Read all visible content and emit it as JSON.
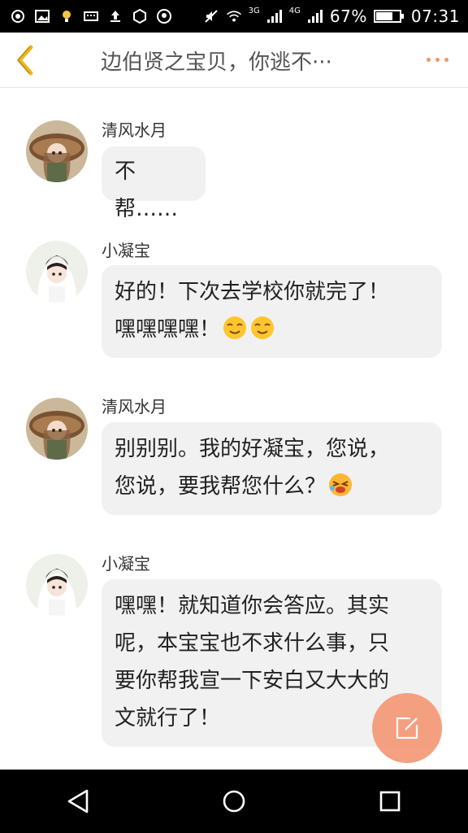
{
  "status_bar": {
    "network_3g": "3G",
    "network_4g": "4G",
    "battery": "67%",
    "time": "07:31"
  },
  "header": {
    "title": "边伯贤之宝贝，你逃不···"
  },
  "messages": [
    {
      "sender": "清风水月",
      "avatar": "girl-hat-avatar",
      "text": "不帮……",
      "emoji": []
    },
    {
      "sender": "小凝宝",
      "avatar": "girl-white-avatar",
      "line1": "好的！下次去学校你就完了！",
      "line2": "嘿嘿嘿嘿！",
      "emoji": [
        "smirk-emoji",
        "smirk-emoji"
      ]
    },
    {
      "sender": "清风水月",
      "avatar": "girl-hat-avatar",
      "line1": "别别别。我的好凝宝，您说，",
      "line2": "您说，要我帮您什么？",
      "emoji": [
        "crying-emoji"
      ]
    },
    {
      "sender": "小凝宝",
      "avatar": "girl-white-avatar",
      "line1": "嘿嘿！就知道你会答应。其实",
      "line2": "呢，本宝宝也不求什么事，只",
      "line3": "要你帮我宣一下安白又大大的",
      "line4": "文就行了！"
    }
  ],
  "icons": {
    "back": "chevron-left-icon",
    "more": "more-dots-icon",
    "compose": "compose-icon"
  },
  "colors": {
    "accent": "#f59977",
    "back_arrow": "#f2b517",
    "bubble": "#f1f1f1"
  }
}
